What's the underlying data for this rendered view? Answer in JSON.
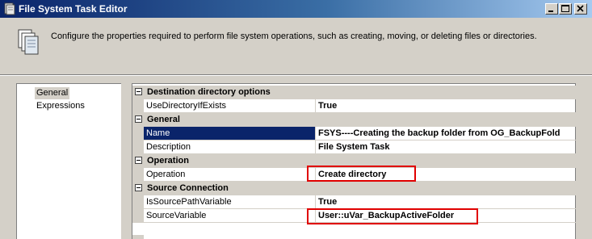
{
  "window": {
    "title": "File System Task Editor",
    "icon": "file-system-task-icon",
    "controls": [
      "minimize-icon",
      "maximize-icon",
      "close-icon"
    ]
  },
  "header": {
    "icon": "documents-icon",
    "description": "Configure the properties required to perform file system operations, such as creating, moving, or deleting files or directories."
  },
  "nav": {
    "items": [
      {
        "label": "General",
        "selected": true
      },
      {
        "label": "Expressions",
        "selected": false
      }
    ]
  },
  "property_grid": {
    "categories": [
      {
        "name": "Destination directory options",
        "properties": [
          {
            "name": "UseDirectoryIfExists",
            "value": "True"
          }
        ]
      },
      {
        "name": "General",
        "properties": [
          {
            "name": "Name",
            "value": "FSYS----Creating the backup folder from OG_BackupFold",
            "selected": true
          },
          {
            "name": "Description",
            "value": "File System Task"
          }
        ]
      },
      {
        "name": "Operation",
        "properties": [
          {
            "name": "Operation",
            "value": "Create directory",
            "highlighted": true
          }
        ]
      },
      {
        "name": "Source Connection",
        "properties": [
          {
            "name": "IsSourcePathVariable",
            "value": "True"
          },
          {
            "name": "SourceVariable",
            "value": "User::uVar_BackupActiveFolder",
            "highlighted": true
          }
        ]
      }
    ]
  },
  "colors": {
    "selection": "#0a246a",
    "highlight_box": "#e00000",
    "dialog_face": "#d4d0c8"
  }
}
